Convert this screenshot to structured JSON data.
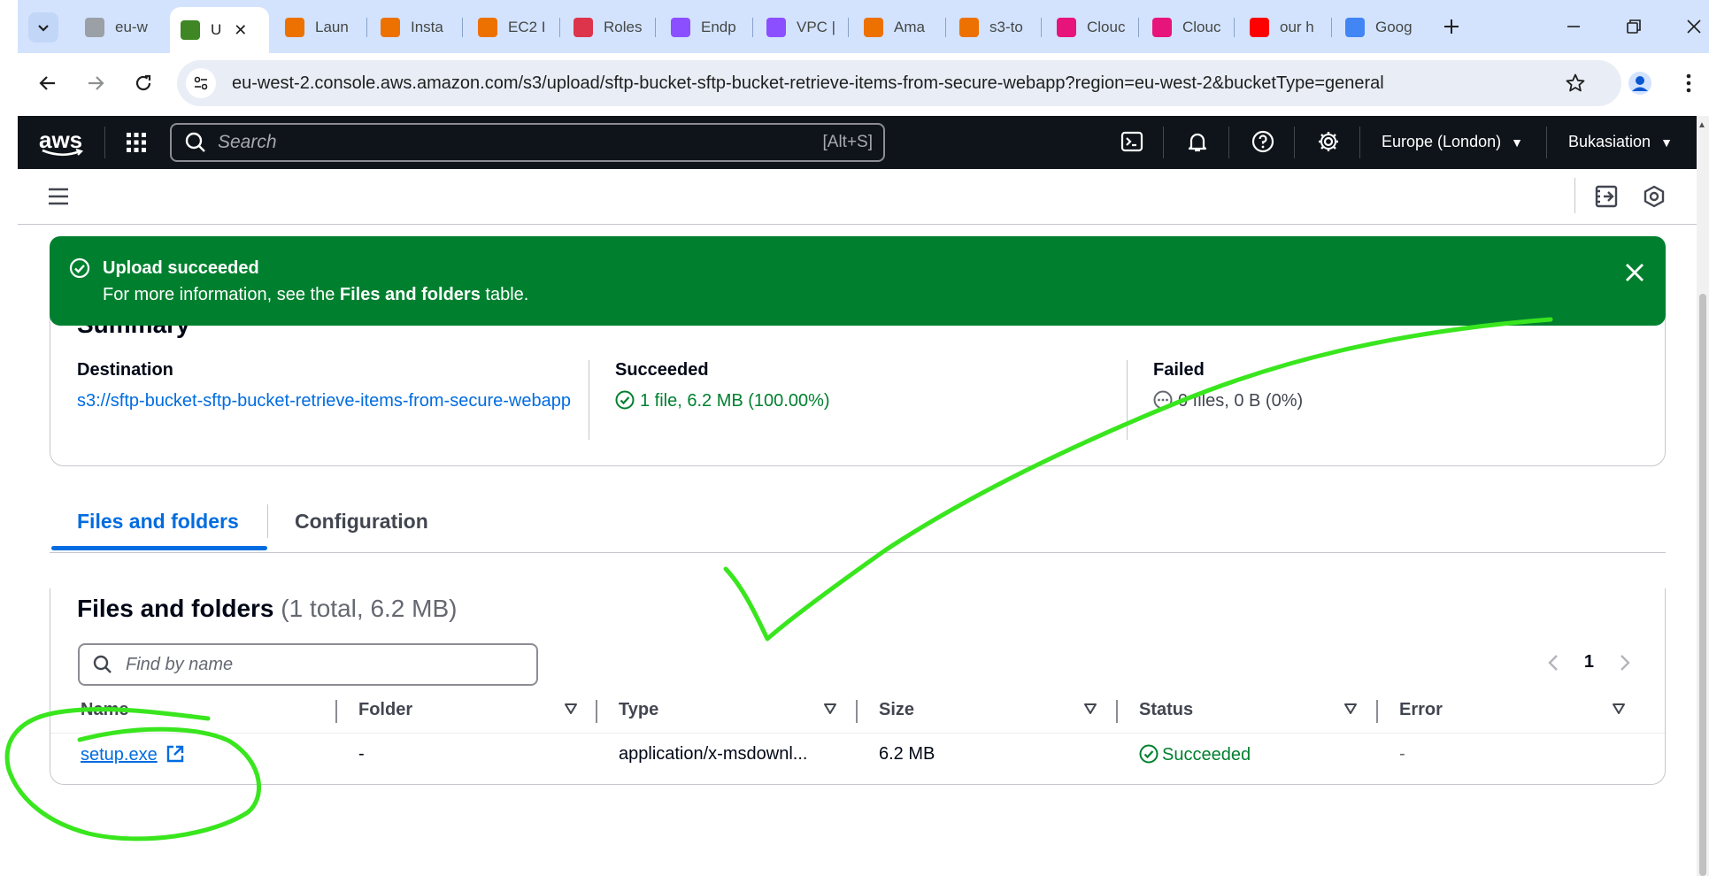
{
  "browser": {
    "tabs": [
      {
        "title": "eu-w",
        "favicon_color": "#9aa0a6"
      },
      {
        "title": "U",
        "favicon_color": "#3f8624",
        "active": true
      },
      {
        "title": "Laun",
        "favicon_color": "#ed7100"
      },
      {
        "title": "Insta",
        "favicon_color": "#ed7100"
      },
      {
        "title": "EC2 I",
        "favicon_color": "#ed7100"
      },
      {
        "title": "Roles",
        "favicon_color": "#dd344c"
      },
      {
        "title": "Endp",
        "favicon_color": "#8c4fff"
      },
      {
        "title": "VPC |",
        "favicon_color": "#8c4fff"
      },
      {
        "title": "Ama",
        "favicon_color": "#ed7100"
      },
      {
        "title": "s3-to",
        "favicon_color": "#ed7100"
      },
      {
        "title": "Clouc",
        "favicon_color": "#e7157b"
      },
      {
        "title": "Clouc",
        "favicon_color": "#e7157b"
      },
      {
        "title": "our h",
        "favicon_color": "#ff0000"
      },
      {
        "title": "Goog",
        "favicon_color": "#4285f4"
      }
    ],
    "url": "eu-west-2.console.aws.amazon.com/s3/upload/sftp-bucket-sftp-bucket-retrieve-items-from-secure-webapp?region=eu-west-2&bucketType=general"
  },
  "aws_nav": {
    "logo": "aws",
    "search_placeholder": "Search",
    "search_shortcut": "[Alt+S]",
    "region": "Europe (London)",
    "account": "Bukasiation"
  },
  "flash": {
    "title": "Upload succeeded",
    "body_prefix": "For more information, see the ",
    "body_bold": "Files and folders",
    "body_suffix": " table."
  },
  "summary": {
    "title": "Summary",
    "destination_label": "Destination",
    "destination_value": "s3://sftp-bucket-sftp-bucket-retrieve-items-from-secure-webapp",
    "succeeded_label": "Succeeded",
    "succeeded_value": "1 file, 6.2 MB (100.00%)",
    "failed_label": "Failed",
    "failed_value": "0 files, 0 B (0%)"
  },
  "tabs": {
    "files": "Files and folders",
    "config": "Configuration"
  },
  "files": {
    "heading": "Files and folders",
    "count": "(1 total, 6.2 MB)",
    "find_placeholder": "Find by name",
    "page": "1",
    "columns": [
      "Name",
      "Folder",
      "Type",
      "Size",
      "Status",
      "Error"
    ],
    "rows": [
      {
        "name": "setup.exe",
        "folder": "-",
        "type": "application/x-msdownl...",
        "size": "6.2 MB",
        "status": "Succeeded",
        "error": "-"
      }
    ]
  },
  "colors": {
    "success": "#00802f",
    "link": "#006ce0",
    "nav_bg": "#0f141a",
    "annotation": "#39e61e"
  }
}
